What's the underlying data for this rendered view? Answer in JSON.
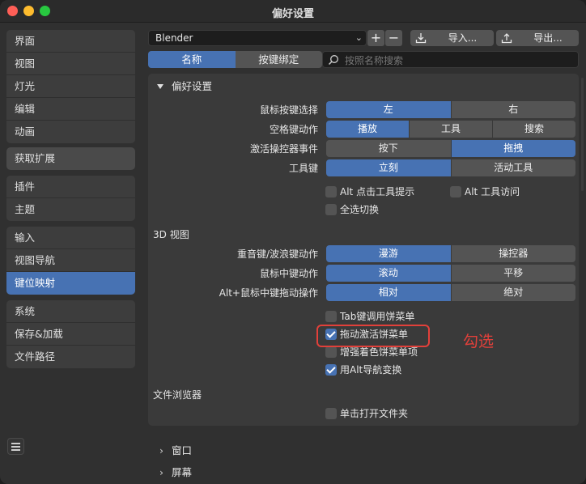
{
  "window": {
    "title": "偏好设置"
  },
  "sidebar": {
    "groups": [
      [
        "界面",
        "视图",
        "灯光",
        "编辑",
        "动画"
      ],
      [
        "获取扩展"
      ],
      [
        "插件",
        "主题"
      ],
      [
        "输入",
        "视图导航",
        "键位映射"
      ],
      [
        "系统",
        "保存&加载",
        "文件路径"
      ]
    ],
    "active": "键位映射"
  },
  "toolbar": {
    "preset": "Blender",
    "add": "+",
    "remove": "−",
    "import_label": "导入...",
    "export_label": "导出..."
  },
  "tabs": {
    "name": "名称",
    "keybinding": "按键绑定",
    "search_placeholder": "按照名称搜索"
  },
  "panel": {
    "header": "偏好设置",
    "rows": [
      {
        "label": "鼠标按键选择",
        "options": [
          "左",
          "右"
        ],
        "selected": 0
      },
      {
        "label": "空格键动作",
        "options": [
          "播放",
          "工具",
          "搜索"
        ],
        "selected": 0
      },
      {
        "label": "激活操控器事件",
        "options": [
          "按下",
          "拖拽"
        ],
        "selected": 1
      },
      {
        "label": "工具键",
        "options": [
          "立刻",
          "活动工具"
        ],
        "selected": 0
      }
    ],
    "checks1": [
      {
        "label": "Alt 点击工具提示",
        "checked": false
      },
      {
        "label": "Alt 工具访问",
        "checked": false
      },
      {
        "label": "全选切换",
        "checked": false
      }
    ],
    "section_3d": "3D 视图",
    "rows3d": [
      {
        "label": "重音键/波浪键动作",
        "options": [
          "漫游",
          "操控器"
        ],
        "selected": 0
      },
      {
        "label": "鼠标中键动作",
        "options": [
          "滚动",
          "平移"
        ],
        "selected": 0
      },
      {
        "label": "Alt+鼠标中键拖动操作",
        "options": [
          "相对",
          "绝对"
        ],
        "selected": 0
      }
    ],
    "checks2": [
      {
        "label": "Tab键调用饼菜单",
        "checked": false
      },
      {
        "label": "拖动激活饼菜单",
        "checked": true
      },
      {
        "label": "增强着色饼菜单项",
        "checked": false
      },
      {
        "label": "用Alt导航变换",
        "checked": true
      }
    ],
    "section_fb": "文件浏览器",
    "check_fb": {
      "label": "单击打开文件夹",
      "checked": false
    }
  },
  "annotation": "勾选",
  "collapsed": {
    "window": "窗口",
    "screen": "屏幕"
  }
}
